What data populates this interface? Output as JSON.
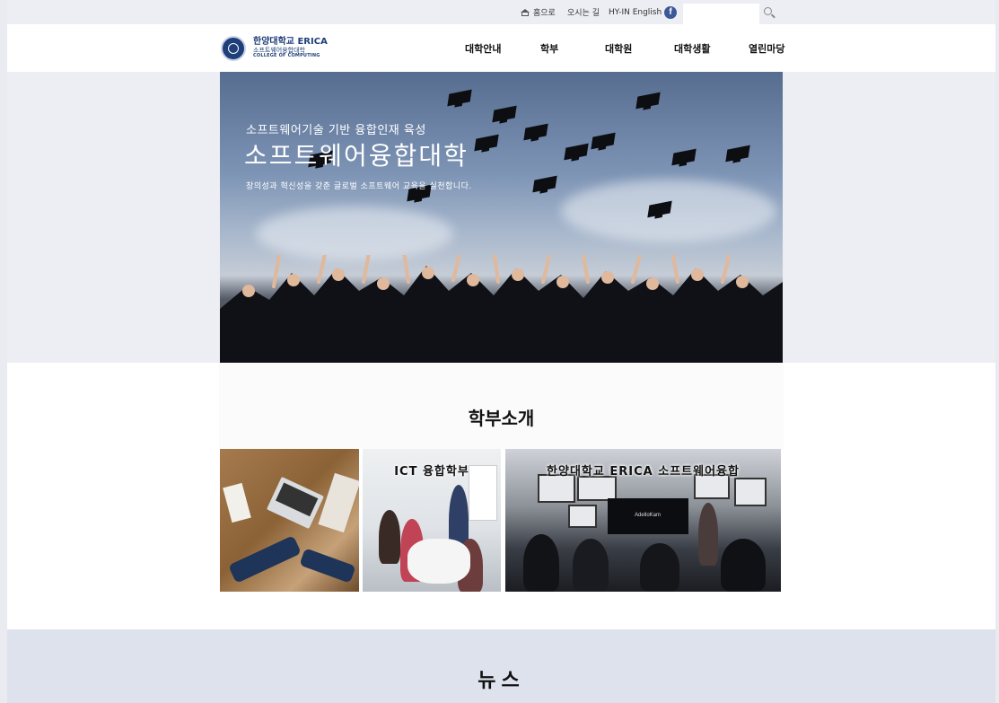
{
  "utility": {
    "home": "홈으로",
    "directions": "오시는 길",
    "english": "HY-IN English",
    "facebook_icon": "facebook-icon",
    "search_placeholder": ""
  },
  "logo": {
    "line1": "한양대학교 ERICA",
    "line2": "소프트웨어융합대학",
    "line3": "COLLEGE OF COMPUTING"
  },
  "nav": {
    "items": [
      "대학안내",
      "학부",
      "대학원",
      "대학생활",
      "열린마당"
    ]
  },
  "hero": {
    "subtitle": "소프트웨어기술 기반 융합인재 육성",
    "title": "소프트웨어융합대학",
    "description": "창의성과 혁신성을 갖춘 글로벌 소프트웨어 교육을 실천합니다."
  },
  "departments": {
    "heading": "학부소개",
    "tiles": [
      {
        "label": ""
      },
      {
        "label": "ICT 융합학부"
      },
      {
        "label": "한양대학교 ERICA 소프트웨어융합"
      }
    ],
    "screen_text": "AdelloKam"
  },
  "news": {
    "heading": "뉴스"
  },
  "colors": {
    "brand": "#1f3f7a",
    "facebook": "#3b5998",
    "news_band": "#dde2ec"
  }
}
